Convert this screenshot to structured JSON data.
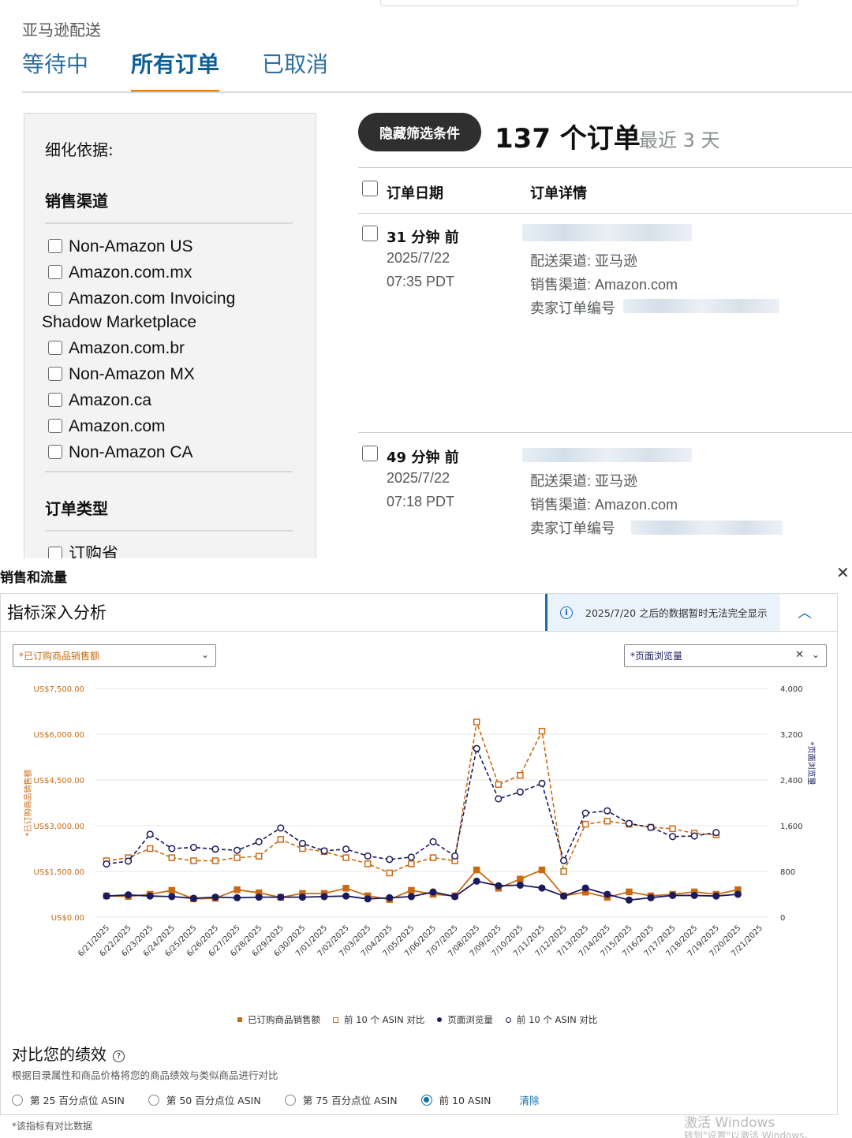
{
  "orders_page": {
    "section_label": "亚马逊配送",
    "tabs": [
      "等待中",
      "所有订单",
      "已取消"
    ],
    "active_tab": "所有订单",
    "filter": {
      "title": "细化依据:",
      "channel_heading": "销售渠道",
      "channels": [
        "Non-Amazon US",
        "Amazon.com.mx",
        "Amazon.com Invoicing",
        "Amazon.com.br",
        "Non-Amazon MX",
        "Amazon.ca",
        "Amazon.com",
        "Non-Amazon CA"
      ],
      "channel_wrap_line": "Shadow Marketplace",
      "order_type_heading": "订单类型",
      "order_types": [
        "订购省"
      ]
    },
    "hide_filters_button": "隐藏筛选条件",
    "order_count": "137 个订单",
    "order_range": "最近 3 天",
    "columns": [
      "订单日期",
      "订单详情"
    ],
    "orders": [
      {
        "ago": "31 分钟 前",
        "date": "2025/7/22",
        "time": "07:35 PDT",
        "fulfillment": "配送渠道: 亚马逊",
        "channel": "销售渠道: Amazon.com",
        "seller_order": "卖家订单编号"
      },
      {
        "ago": "49 分钟 前",
        "date": "2025/7/22",
        "time": "07:18 PDT",
        "fulfillment": "配送渠道: 亚马逊",
        "channel": "销售渠道: Amazon.com",
        "seller_order": "卖家订单编号"
      }
    ]
  },
  "analytics": {
    "panel_title": "销售和流量",
    "close_icon": "close-icon",
    "card_title": "指标深入分析",
    "notice": "2025/7/20 之后的数据暂时无法完全显示",
    "left_select": "*已订购商品销售额",
    "right_select": "*页面浏览量",
    "legend": [
      "已订购商品销售额",
      "前 10 个 ASIN 对比",
      "页面浏览量",
      "前 10 个 ASIN 对比"
    ],
    "compare_title": "对比您的绩效",
    "compare_desc": "根据目录属性和商品价格将您的商品绩效与类似商品进行对比",
    "radio_options": [
      "第 25 百分点位 ASIN",
      "第 50 百分点位 ASIN",
      "第 75 百分点位 ASIN",
      "前 10 ASIN"
    ],
    "radio_selected": "前 10 ASIN",
    "clear_link": "清除",
    "footnote": "*该指标有对比数据",
    "watermark_title": "激活 Windows",
    "watermark_sub": "转到\"设置\"以激活 Windows。"
  },
  "chart_data": {
    "type": "line",
    "x": [
      "6/21/2025",
      "6/22/2025",
      "6/23/2025",
      "6/24/2025",
      "6/25/2025",
      "6/26/2025",
      "6/27/2025",
      "6/28/2025",
      "6/29/2025",
      "6/30/2025",
      "7/01/2025",
      "7/02/2025",
      "7/03/2025",
      "7/04/2025",
      "7/05/2025",
      "7/06/2025",
      "7/07/2025",
      "7/08/2025",
      "7/09/2025",
      "7/10/2025",
      "7/11/2025",
      "7/12/2025",
      "7/13/2025",
      "7/14/2025",
      "7/15/2025",
      "7/16/2025",
      "7/17/2025",
      "7/18/2025",
      "7/19/2025",
      "7/20/2025",
      "7/21/2025"
    ],
    "left_axis": {
      "label": "*已订购商品销售额",
      "ticks": [
        "US$0.00",
        "US$1,500.00",
        "US$3,000.00",
        "US$4,500.00",
        "US$6,000.00",
        "US$7,500.00"
      ],
      "ylim": [
        0,
        7500
      ],
      "color": "#c96a12"
    },
    "right_axis": {
      "label": "*页面浏览量",
      "ticks": [
        "0",
        "800",
        "1,600",
        "2,400",
        "3,200",
        "4,000"
      ],
      "ylim": [
        0,
        4000
      ],
      "color": "#1a1a5e"
    },
    "series": [
      {
        "name": "已订购商品销售额",
        "axis": "left",
        "style": "solid-square",
        "color": "#c96a12",
        "values": [
          700,
          680,
          750,
          880,
          600,
          620,
          900,
          800,
          650,
          780,
          780,
          950,
          700,
          580,
          880,
          750,
          700,
          1550,
          950,
          1250,
          1550,
          700,
          820,
          650,
          830,
          700,
          750,
          830,
          750,
          900,
          null
        ]
      },
      {
        "name": "前 10 个 ASIN 对比",
        "axis": "left",
        "style": "dashed-open-square",
        "color": "#c96a12",
        "values": [
          1850,
          1950,
          2250,
          1950,
          1850,
          1850,
          1950,
          2000,
          2550,
          2250,
          2150,
          1950,
          1750,
          1450,
          1750,
          1950,
          1850,
          6400,
          4350,
          4650,
          6100,
          1500,
          3050,
          3150,
          3050,
          2950,
          2900,
          2750,
          2700,
          null,
          null
        ]
      },
      {
        "name": "页面浏览量",
        "axis": "right",
        "style": "solid-dot",
        "color": "#1a1a5e",
        "values": [
          370,
          390,
          370,
          360,
          330,
          350,
          340,
          350,
          350,
          350,
          360,
          370,
          320,
          340,
          360,
          440,
          360,
          630,
          550,
          560,
          510,
          370,
          510,
          400,
          300,
          340,
          380,
          380,
          370,
          400,
          null
        ]
      },
      {
        "name": "前 10 个 ASIN 对比",
        "axis": "right",
        "style": "dashed-open-dot",
        "color": "#1a1a5e",
        "values": [
          930,
          980,
          1450,
          1200,
          1220,
          1190,
          1170,
          1320,
          1560,
          1290,
          1160,
          1190,
          1070,
          1010,
          1050,
          1320,
          1070,
          2950,
          2070,
          2190,
          2340,
          990,
          1820,
          1860,
          1640,
          1570,
          1410,
          1420,
          1480,
          null,
          null
        ]
      }
    ]
  }
}
